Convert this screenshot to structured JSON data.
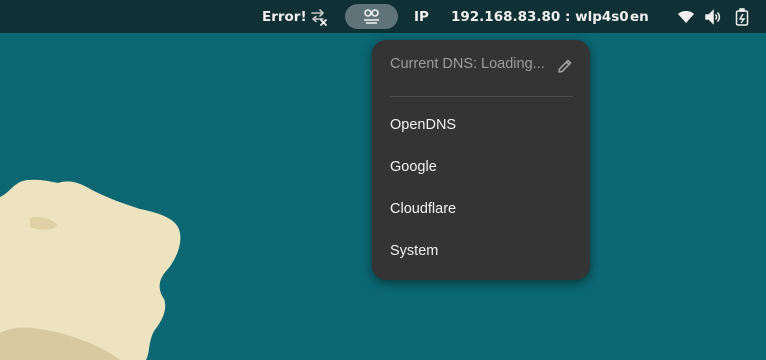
{
  "topbar": {
    "status_text": "Error!",
    "transfer_icon": "arrows-swap-x-icon",
    "dns_icon": "double-circle-icon",
    "ip_label": "IP",
    "ip_value": "192.168.83.80 : wlp4s0",
    "keyboard_layout": "en",
    "wifi_icon": "wifi-icon",
    "volume_icon": "speaker-icon",
    "battery_icon": "battery-charging-icon"
  },
  "menu": {
    "current_dns_label": "Current DNS: Loading...",
    "edit_icon": "pencil-icon",
    "items": [
      {
        "label": "OpenDNS"
      },
      {
        "label": "Google"
      },
      {
        "label": "Cloudflare"
      },
      {
        "label": "System"
      }
    ]
  },
  "colors": {
    "desktop_background": "#0b6772",
    "topbar_background": "#0f3034",
    "menu_background": "#343434",
    "pill_background": "#5f7478",
    "blob_fill": "#eee3c0"
  }
}
